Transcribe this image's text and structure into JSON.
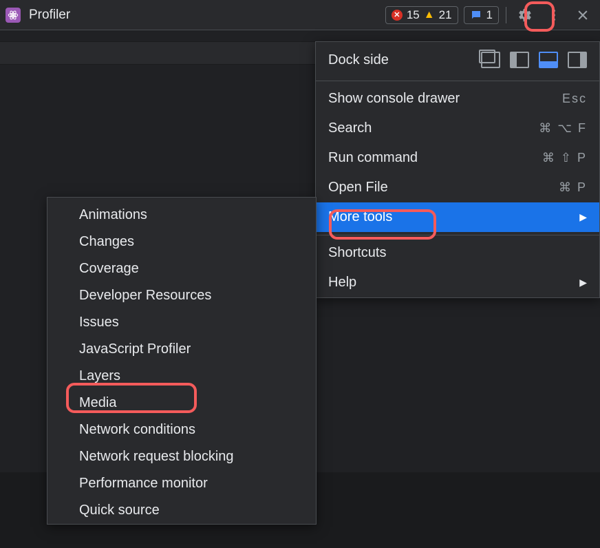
{
  "toolbar": {
    "active_tab": "Profiler",
    "errors": "15",
    "warnings": "21",
    "messages": "1"
  },
  "main_menu": {
    "dock_label": "Dock side",
    "items": [
      {
        "label": "Show console drawer",
        "shortcut": "Esc"
      },
      {
        "label": "Search",
        "shortcut": "⌘ ⌥ F"
      },
      {
        "label": "Run command",
        "shortcut": "⌘ ⇧ P"
      },
      {
        "label": "Open File",
        "shortcut": "⌘ P"
      },
      {
        "label": "More tools",
        "submenu": true,
        "selected": true
      }
    ],
    "footer": [
      {
        "label": "Shortcuts"
      },
      {
        "label": "Help",
        "submenu": true
      }
    ]
  },
  "more_tools": {
    "items": [
      "Animations",
      "Changes",
      "Coverage",
      "Developer Resources",
      "Issues",
      "JavaScript Profiler",
      "Layers",
      "Media",
      "Network conditions",
      "Network request blocking",
      "Performance monitor",
      "Quick source"
    ]
  }
}
